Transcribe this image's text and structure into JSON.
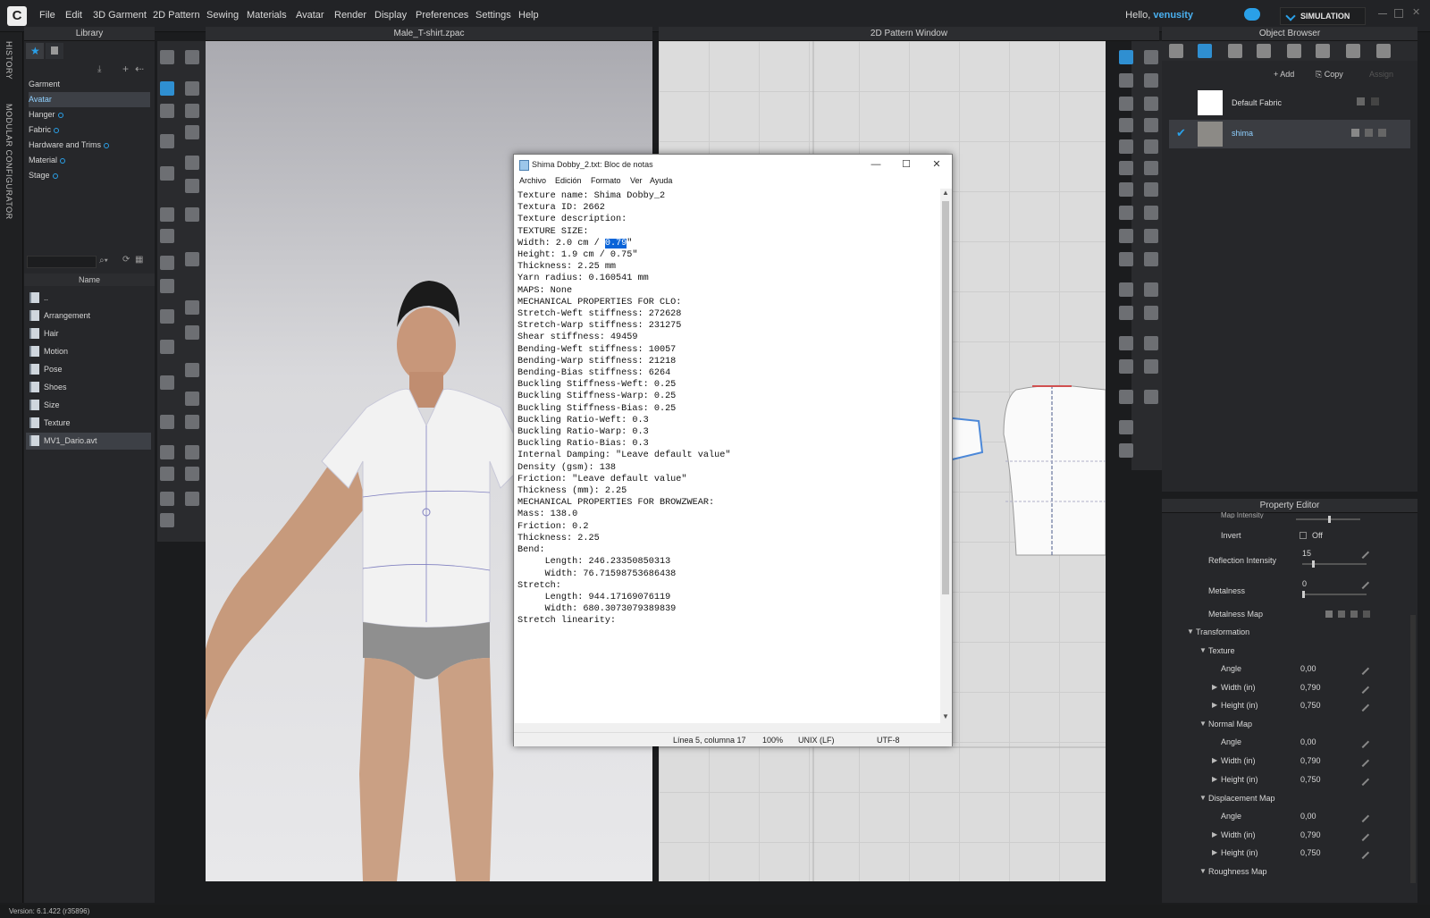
{
  "app": {
    "logo": "C",
    "menu": [
      "File",
      "Edit",
      "3D Garment",
      "2D Pattern",
      "Sewing",
      "Materials",
      "Avatar",
      "Render",
      "Display",
      "Preferences",
      "Settings",
      "Help"
    ],
    "greeting": "Hello,",
    "username": "venusity",
    "mode": "SIMULATION"
  },
  "sidetabs": [
    "HISTORY",
    "MODULAR CONFIGURATOR"
  ],
  "library": {
    "title": "Library",
    "categories": [
      "Garment",
      "Avatar",
      "Hanger",
      "Fabric",
      "Hardware and Trims",
      "Material",
      "Stage"
    ],
    "selected_category": "Avatar",
    "column_header": "Name",
    "files": [
      "..",
      "Arrangement",
      "Hair",
      "Motion",
      "Pose",
      "Shoes",
      "Size",
      "Texture",
      "MV1_Dario.avt"
    ],
    "selected_file": "MV1_Dario.avt"
  },
  "viewport3d": {
    "title": "Male_T-shirt.zpac"
  },
  "viewport2d": {
    "title": "2D Pattern Window"
  },
  "object_browser": {
    "title": "Object Browser",
    "add_label": "Add",
    "copy_label": "Copy",
    "assign_label": "Assign",
    "fabrics": [
      {
        "name": "Default Fabric",
        "checked": false
      },
      {
        "name": "shima",
        "checked": true
      }
    ]
  },
  "property_editor": {
    "title": "Property Editor",
    "cut_label": "Map Intensity",
    "invert_label": "Invert",
    "invert_value": "Off",
    "reflection_label": "Reflection Intensity",
    "reflection_value": "15",
    "metalness_label": "Metalness",
    "metalness_value": "0",
    "metalness_map_label": "Metalness Map",
    "transformation_label": "Transformation",
    "groups": [
      {
        "name": "Texture",
        "angle": "0,00",
        "width": "0,790",
        "height": "0,750"
      },
      {
        "name": "Normal Map",
        "angle": "0,00",
        "width": "0,790",
        "height": "0,750"
      },
      {
        "name": "Displacement Map",
        "angle": "0,00",
        "width": "0,790",
        "height": "0,750"
      }
    ],
    "angle_label": "Angle",
    "width_label": "Width (in)",
    "height_label": "Height (in)",
    "roughness_label": "Roughness Map"
  },
  "notepad": {
    "title": "Shima Dobby_2.txt: Bloc de notas",
    "menu": [
      "Archivo",
      "Edición",
      "Formato",
      "Ver",
      "Ayuda"
    ],
    "lines": [
      "Texture name: Shima Dobby_2",
      "Textura ID: 2662",
      "Texture description:",
      "TEXTURE SIZE:",
      "Width: 2.0 cm / ",
      "Height: 1.9 cm / 0.75\"",
      "Thickness: 2.25 mm",
      "Yarn radius: 0.160541 mm",
      "",
      "MAPS: None",
      "MECHANICAL PROPERTIES FOR CLO:",
      "",
      "Stretch-Weft stiffness: 272628",
      "Stretch-Warp stiffness: 231275",
      "Shear stiffness: 49459",
      "Bending-Weft stiffness: 10057",
      "Bending-Warp stiffness: 21218",
      "Bending-Bias stiffness: 6264",
      "Buckling Stiffness-Weft: 0.25",
      "Buckling Stiffness-Warp: 0.25",
      "Buckling Stiffness-Bias: 0.25",
      "Buckling Ratio-Weft: 0.3",
      "Buckling Ratio-Warp: 0.3",
      "Buckling Ratio-Bias: 0.3",
      "Internal Damping: \"Leave default value\"",
      "Density (gsm): 138",
      "Friction: \"Leave default value\"",
      "Thickness (mm): 2.25",
      "",
      "",
      "MECHANICAL PROPERTIES FOR BROWZWEAR:",
      "",
      "Mass: 138.0",
      "Friction: 0.2",
      "Thickness: 2.25",
      "",
      "Bend:",
      "     Length: 246.23350850313",
      "     Width: 76.71598753686438",
      "",
      "Stretch:",
      "     Length: 944.17169076119",
      "     Width: 680.3073079389839",
      "",
      "Stretch linearity:"
    ],
    "selected_text": "0.79",
    "after_selection": "\"",
    "status": {
      "position": "Línea 5, columna 17",
      "zoom": "100%",
      "eol": "UNIX (LF)",
      "encoding": "UTF-8"
    }
  },
  "statusbar": {
    "version": "Version: 6.1.422 (r35896)"
  },
  "colors": {
    "accent": "#2aa0e8",
    "selection": "#0a64d8",
    "panel": "#26272a"
  }
}
